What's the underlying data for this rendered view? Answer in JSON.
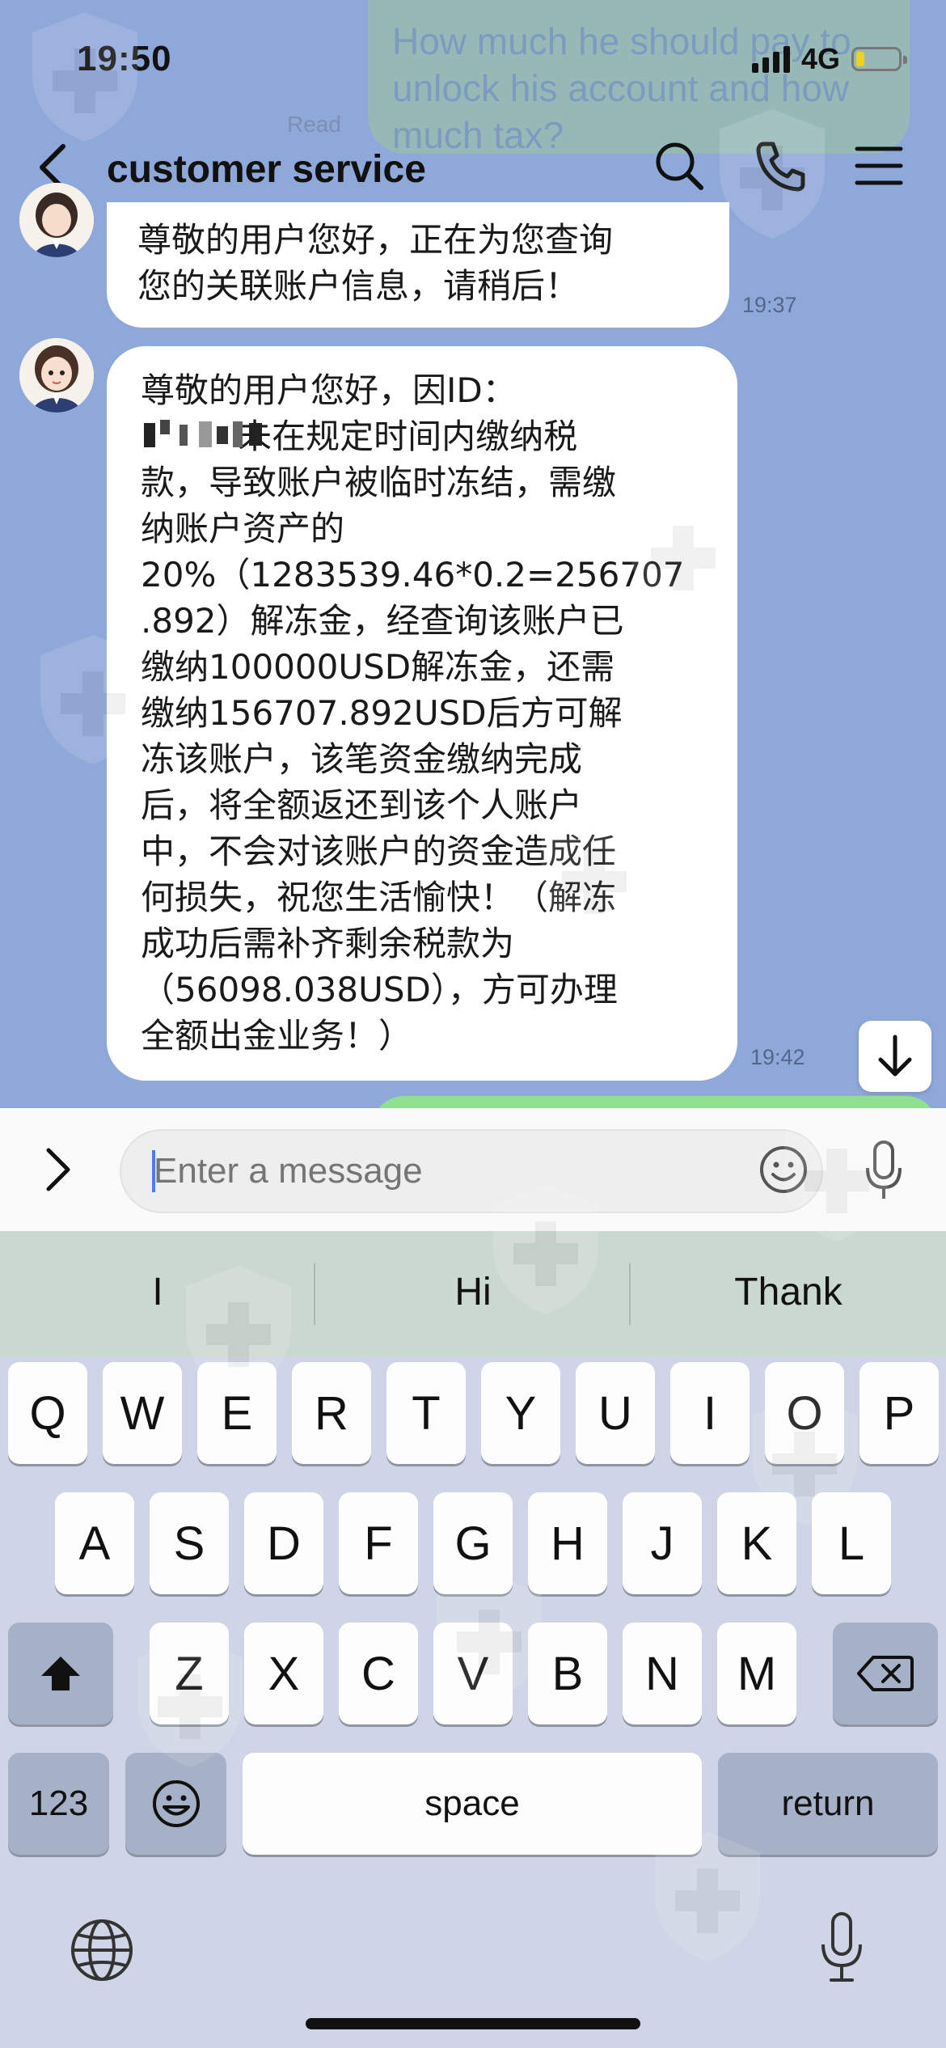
{
  "status_bar": {
    "time": "19:50",
    "network": "4G"
  },
  "faded_sent_message": {
    "text": "How much he should pay to\nunlock his account and how\nmuch tax?",
    "read_label": "Read"
  },
  "header": {
    "title": "customer service"
  },
  "messages": [
    {
      "text": "尊敬的用户您好，正在为您查询\n您的关联账户信息，请稍后！",
      "time": "19:37"
    },
    {
      "text": "尊敬的用户您好，因ID：\n         未在规定时间内缴纳税\n款，导致账户被临时冻结，需缴\n纳账户资产的\n20%（1283539.46*0.2=256707\n.892）解冻金，经查询该账户已\n缴纳100000USD解冻金，还需\n缴纳156707.892USD后方可解\n冻该账户，该笔资金缴纳完成\n后，将全额返还到该个人账户\n中，不会对该账户的资金造成任\n何损失，祝您生活愉快！（解冻\n成功后需补齐剩余税款为\n（56098.038USD），方可办理\n全额出金业务！）",
      "time": "19:42"
    }
  ],
  "composer": {
    "placeholder": "Enter a message"
  },
  "keyboard": {
    "suggestions": [
      "I",
      "Hi",
      "Thank"
    ],
    "row1": [
      "Q",
      "W",
      "E",
      "R",
      "T",
      "Y",
      "U",
      "I",
      "O",
      "P"
    ],
    "row2": [
      "A",
      "S",
      "D",
      "F",
      "G",
      "H",
      "J",
      "K",
      "L"
    ],
    "row3": [
      "Z",
      "X",
      "C",
      "V",
      "B",
      "N",
      "M"
    ],
    "numbers_key": "123",
    "space_key": "space",
    "return_key": "return"
  },
  "colors": {
    "chat_bg": "#8fa8da",
    "bubble": "#ffffff",
    "keyboard_bg": "#cfd5e6",
    "accent_caret": "#4a7cf7"
  },
  "icons": [
    "back-icon",
    "search-icon",
    "phone-icon",
    "menu-icon",
    "arrow-down-icon",
    "expand-icon",
    "smiley-icon",
    "microphone-icon",
    "shift-icon",
    "backspace-icon",
    "emoji-icon",
    "globe-icon",
    "dictation-icon"
  ]
}
